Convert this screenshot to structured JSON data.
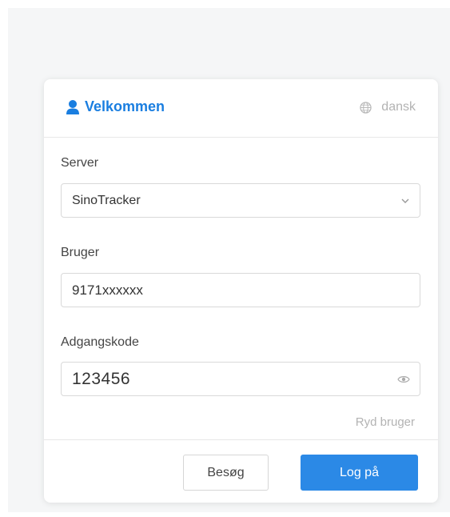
{
  "header": {
    "title": "Velkommen",
    "language": "dansk"
  },
  "form": {
    "server": {
      "label": "Server",
      "value": "SinoTracker"
    },
    "user": {
      "label": "Bruger",
      "value": "9171xxxxxx"
    },
    "password": {
      "label": "Adgangskode",
      "value": "123456"
    },
    "clear_user": "Ryd bruger"
  },
  "buttons": {
    "visit": "Besøg",
    "login": "Log på"
  },
  "colors": {
    "accent": "#1a7ee0",
    "primary_button": "#2b89e6",
    "muted_text": "#b3b3b3"
  },
  "icons": [
    "user-icon",
    "globe-icon",
    "chevron-down-icon",
    "eye-icon"
  ]
}
